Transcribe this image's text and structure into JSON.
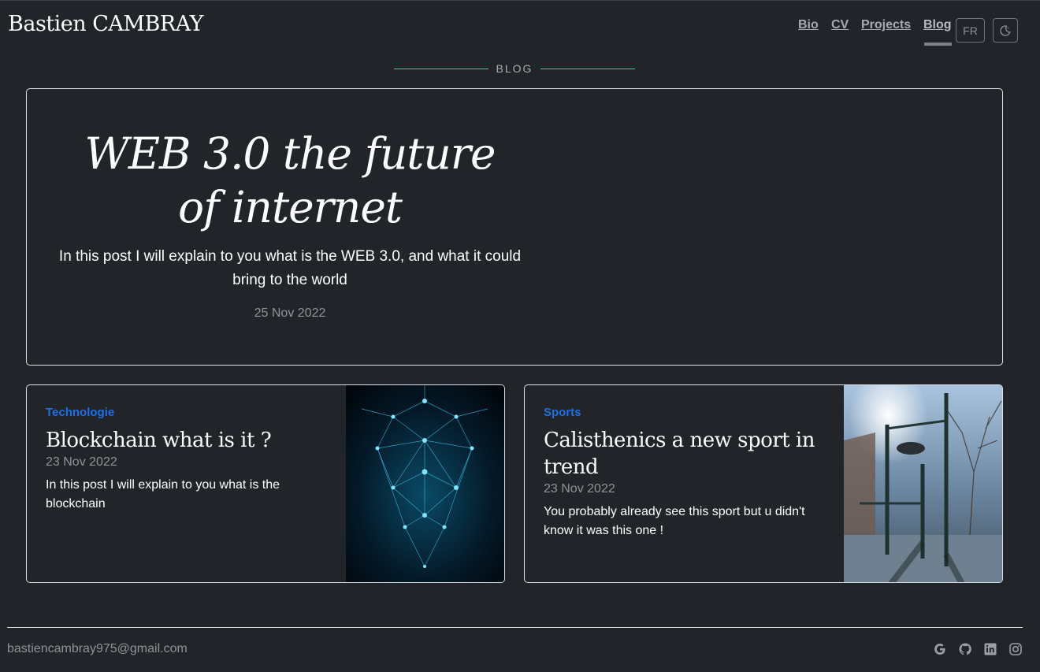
{
  "header": {
    "site_title": "Bastien CAMBRAY",
    "nav": [
      {
        "label": "Bio"
      },
      {
        "label": "CV"
      },
      {
        "label": "Projects"
      },
      {
        "label": "Blog",
        "active": true
      }
    ],
    "lang_button": "FR",
    "theme_toggle_icon": "moon-icon"
  },
  "section": {
    "heading": "BLOG"
  },
  "featured_post": {
    "title": "WEB 3.0 the future of internet",
    "description": "In this post I will explain to you what is the WEB 3.0, and what it could bring to the world",
    "date": "25 Nov 2022"
  },
  "posts": [
    {
      "category": "Technologie",
      "title": "Blockchain what is it ?",
      "date": "23 Nov 2022",
      "description": "In this post I will explain to you what is the blockchain",
      "image_icon": "network-graph-image"
    },
    {
      "category": "Sports",
      "title": "Calisthenics a new sport in trend",
      "date": "23 Nov 2022",
      "description": "You probably already see this sport but u didn't know it was this one !",
      "image_icon": "outdoor-park-photo"
    }
  ],
  "footer": {
    "email": "bastiencambray975@gmail.com",
    "social": [
      "google-icon",
      "github-icon",
      "linkedin-icon",
      "instagram-icon"
    ]
  },
  "colors": {
    "background": "#212529",
    "accent_line": "#3dd68c",
    "category": "#1f6fe8",
    "muted_text": "#8f9498"
  }
}
